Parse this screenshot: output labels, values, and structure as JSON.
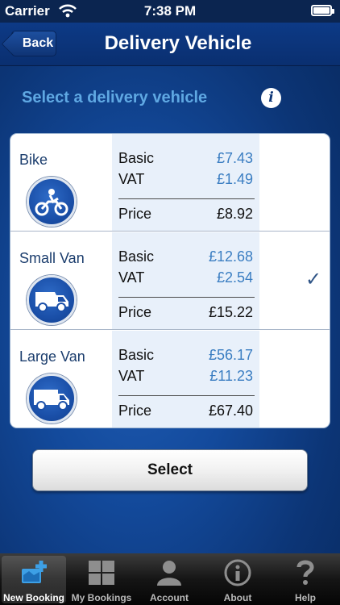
{
  "status_bar": {
    "carrier": "Carrier",
    "time": "7:38 PM"
  },
  "nav": {
    "back_label": "Back",
    "title": "Delivery Vehicle"
  },
  "heading": "Select a delivery vehicle",
  "vehicles": [
    {
      "name": "Bike",
      "icon": "motorbike-icon",
      "basic_label": "Basic",
      "basic": "£7.43",
      "vat_label": "VAT",
      "vat": "£1.49",
      "price_label": "Price",
      "price": "£8.92",
      "selected": false
    },
    {
      "name": "Small Van",
      "icon": "small-van-icon",
      "basic_label": "Basic",
      "basic": "£12.68",
      "vat_label": "VAT",
      "vat": "£2.54",
      "price_label": "Price",
      "price": "£15.22",
      "selected": true
    },
    {
      "name": "Large Van",
      "icon": "large-van-icon",
      "basic_label": "Basic",
      "basic": "£56.17",
      "vat_label": "VAT",
      "vat": "£11.23",
      "price_label": "Price",
      "price": "£67.40",
      "selected": false
    }
  ],
  "select_button": "Select",
  "tabs": [
    {
      "label": "New Booking",
      "icon": "new-booking-icon",
      "active": true
    },
    {
      "label": "My Bookings",
      "icon": "grid-icon",
      "active": false
    },
    {
      "label": "Account",
      "icon": "person-icon",
      "active": false
    },
    {
      "label": "About",
      "icon": "info-icon",
      "active": false
    },
    {
      "label": "Help",
      "icon": "question-icon",
      "active": false
    }
  ],
  "colors": {
    "accent": "#5fa8e3",
    "nav": "#0a2f70",
    "price_value": "#3b7ec2"
  }
}
